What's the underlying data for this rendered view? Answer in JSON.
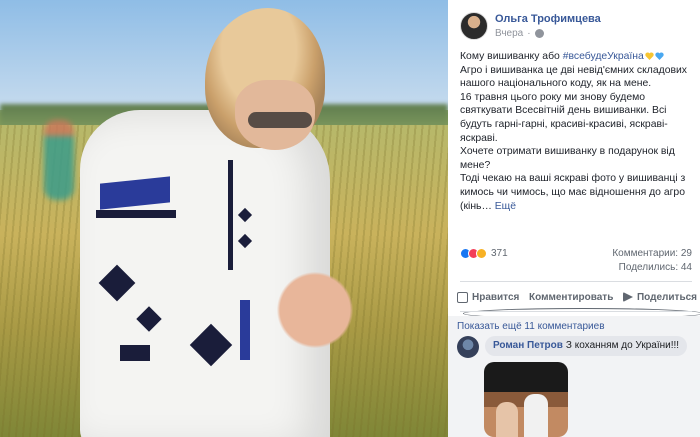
{
  "post": {
    "author": "Ольга Трофимцева",
    "time": "Вчера",
    "text": {
      "line1_pre": "Кому вишиванку або ",
      "hashtag": "#всебудеУкраїна",
      "para2": "Агро і вишиванка це дві невід'ємних складових нашого національного коду, як на мене.",
      "para3": "16 травня цього року ми знову будемо святкувати Всесвітній день вишиванки. Всі будуть гарні-гарні, красиві-красиві, яскраві-яскраві.",
      "para4": "Хочете отримати вишиванку в подарунок від мене?",
      "para5": "Тоді чекаю на ваші яскраві фото у вишиванці з кимось чи чимось, що має відношення до агро (кінь…",
      "see_more": "Ещё"
    },
    "reaction_count": "371",
    "comments_count": "Комментарии: 29",
    "shares_count": "Поделились: 44",
    "actions": {
      "like": "Нравится",
      "comment": "Комментировать",
      "share": "Поделиться"
    }
  },
  "comments": {
    "show_more": "Показать ещё 11 комментариев",
    "items": [
      {
        "author": "Роман Петров",
        "text": "З коханням до України!!!"
      }
    ]
  },
  "colors": {
    "link": "#385898",
    "like": "#1877f2",
    "love": "#f33e58",
    "wow": "#f7b125"
  },
  "icons": [
    "globe-icon",
    "like-icon",
    "comment-icon",
    "share-icon",
    "heart-icon"
  ]
}
